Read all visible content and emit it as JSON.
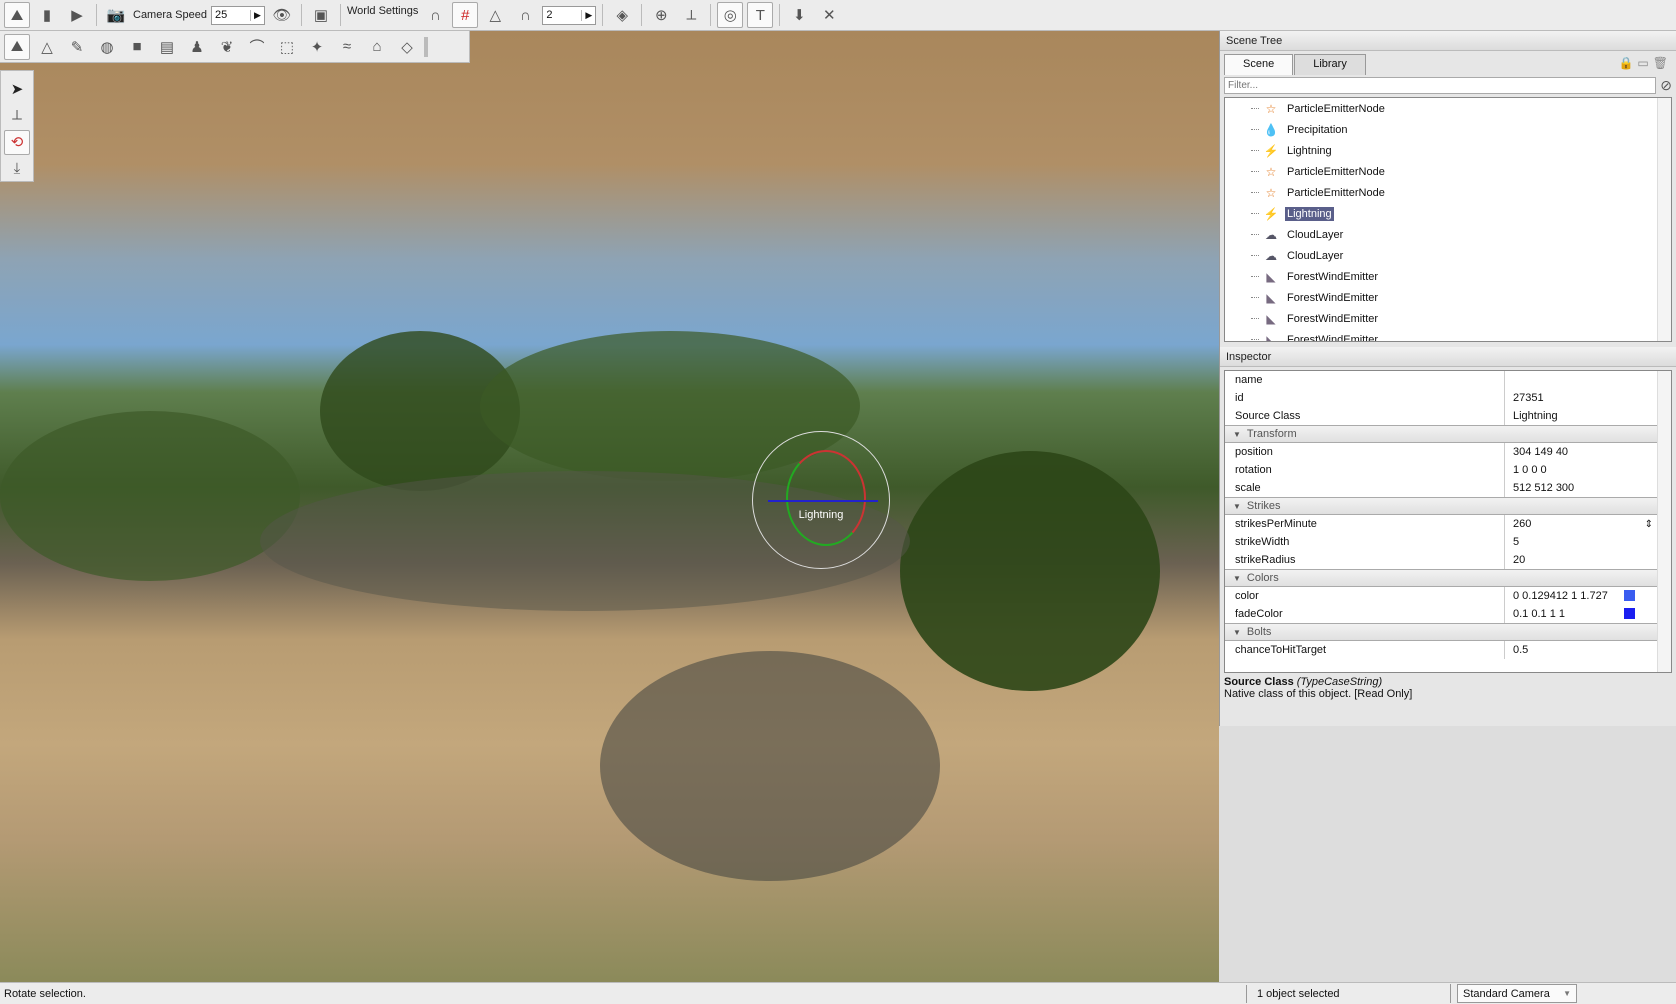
{
  "toolbar": {
    "camera_speed_label": "Camera Speed",
    "camera_speed_value": "25",
    "world_settings_label": "World Settings",
    "grid_value": "2"
  },
  "scene_tree": {
    "title": "Scene Tree",
    "tabs": [
      "Scene",
      "Library"
    ],
    "filter_placeholder": "Filter...",
    "items": [
      {
        "label": "ParticleEmitterNode",
        "icon": "star-icon"
      },
      {
        "label": "Precipitation",
        "icon": "droplet-icon"
      },
      {
        "label": "Lightning",
        "icon": "lightning-icon"
      },
      {
        "label": "ParticleEmitterNode",
        "icon": "star-icon"
      },
      {
        "label": "ParticleEmitterNode",
        "icon": "star-icon"
      },
      {
        "label": "Lightning",
        "icon": "lightning-icon",
        "selected": true
      },
      {
        "label": "CloudLayer",
        "icon": "cloud-icon"
      },
      {
        "label": "CloudLayer",
        "icon": "cloud-icon"
      },
      {
        "label": "ForestWindEmitter",
        "icon": "wind-emitter-icon"
      },
      {
        "label": "ForestWindEmitter",
        "icon": "wind-emitter-icon"
      },
      {
        "label": "ForestWindEmitter",
        "icon": "wind-emitter-icon"
      },
      {
        "label": "ForestWindEmitter",
        "icon": "wind-emitter-icon"
      }
    ]
  },
  "inspector": {
    "title": "Inspector",
    "sections": [
      {
        "group": null,
        "rows": [
          {
            "k": "name",
            "v": ""
          },
          {
            "k": "id",
            "v": "27351"
          },
          {
            "k": "Source Class",
            "v": "Lightning"
          }
        ]
      },
      {
        "group": "Transform",
        "rows": [
          {
            "k": "position",
            "v": "304 149 40"
          },
          {
            "k": "rotation",
            "v": "1 0 0 0"
          },
          {
            "k": "scale",
            "v": "512 512 300"
          }
        ]
      },
      {
        "group": "Strikes",
        "rows": [
          {
            "k": "strikesPerMinute",
            "v": "260"
          },
          {
            "k": "strikeWidth",
            "v": "5"
          },
          {
            "k": "strikeRadius",
            "v": "20"
          }
        ]
      },
      {
        "group": "Colors",
        "rows": [
          {
            "k": "color",
            "v": "0 0.129412 1 1.727",
            "swatch": "#3a5cf0"
          },
          {
            "k": "fadeColor",
            "v": "0.1 0.1 1 1",
            "swatch": "#1a1ef0"
          }
        ]
      },
      {
        "group": "Bolts",
        "rows": [
          {
            "k": "chanceToHitTarget",
            "v": "0.5"
          }
        ]
      }
    ],
    "help_title": "Source Class",
    "help_type": "(TypeCaseString)",
    "help_text": "Native class of this object. [Read Only]"
  },
  "viewport": {
    "gizmo_label": "Lightning"
  },
  "status": {
    "message": "Rotate selection.",
    "selection": "1 object selected",
    "camera": "Standard Camera"
  }
}
